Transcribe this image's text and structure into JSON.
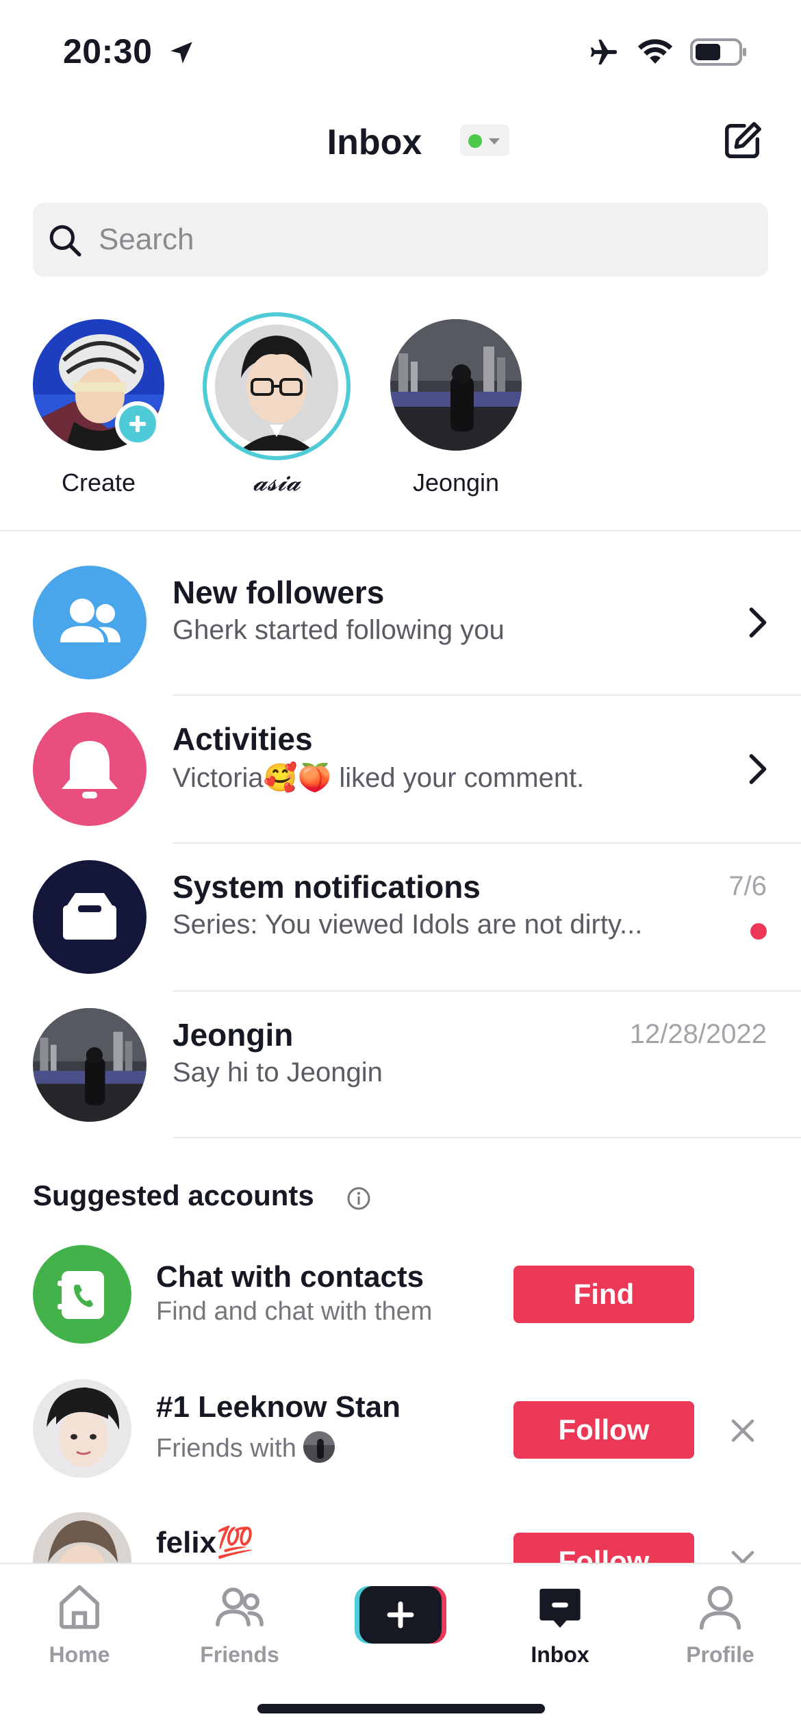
{
  "status_bar": {
    "time": "20:30"
  },
  "header": {
    "title": "Inbox"
  },
  "search": {
    "placeholder": "Search"
  },
  "stories": [
    {
      "name": "Create"
    },
    {
      "name": "𝓪𝓼𝓲𝓪"
    },
    {
      "name": "Jeongin"
    }
  ],
  "rows": [
    {
      "title": "New followers",
      "subtitle": "Gherk started following you"
    },
    {
      "title": "Activities",
      "subtitle": "Victoria🥰🍑 liked your comment."
    },
    {
      "title": "System notifications",
      "subtitle": "Series: You viewed Idols are not dirty...",
      "date": "7/6"
    },
    {
      "title": "Jeongin",
      "subtitle": "Say hi to Jeongin",
      "date": "12/28/2022"
    }
  ],
  "suggested": {
    "title": "Suggested accounts",
    "items": [
      {
        "name": "Chat with contacts",
        "subtitle": "Find and chat with them",
        "button": "Find"
      },
      {
        "name": "#1 Leeknow Stan",
        "subtitle": "Friends with",
        "button": "Follow"
      },
      {
        "name": "felix💯",
        "subtitle": "",
        "button": "Follow"
      }
    ]
  },
  "nav": [
    {
      "label": "Home"
    },
    {
      "label": "Friends"
    },
    {
      "label": "Inbox"
    },
    {
      "label": "Profile"
    }
  ],
  "colors": {
    "accent_red": "#ea3856",
    "teal": "#4ecbd6",
    "followers_blue": "#4aa6ea",
    "activities_pink": "#e94f7c",
    "system_navy": "#14163a",
    "contacts_green": "#44b24a",
    "online_green": "#4cc94a"
  },
  "icons": [
    "location-arrow-icon",
    "airplane-icon",
    "wifi-icon",
    "battery-icon",
    "compose-icon",
    "search-icon",
    "people-icon",
    "bell-icon",
    "inbox-box-icon",
    "chevron-right-icon",
    "info-icon",
    "phone-book-icon",
    "close-icon",
    "home-icon",
    "friends-icon",
    "plus-icon",
    "inbox-icon",
    "profile-icon"
  ]
}
